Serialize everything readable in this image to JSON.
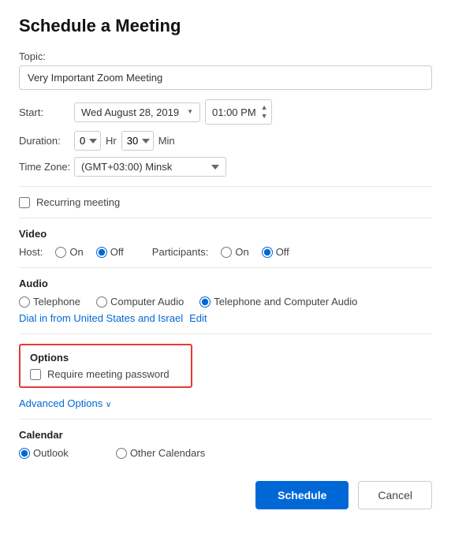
{
  "page": {
    "title": "Schedule a Meeting"
  },
  "topic": {
    "label": "Topic:",
    "value": "Very Important Zoom Meeting",
    "placeholder": "Very Important Zoom Meeting"
  },
  "start": {
    "label": "Start:",
    "date": {
      "weekday": "Wed",
      "month": "August",
      "day": "28,",
      "year": "2019",
      "display": "Wed  August  28, 2019"
    },
    "time": "01:00 PM"
  },
  "duration": {
    "label": "Duration:",
    "hours_value": "0",
    "hr_label": "Hr",
    "minutes_value": "30",
    "min_label": "Min"
  },
  "timezone": {
    "label": "Time Zone:",
    "value": "(GMT+03:00) Minsk"
  },
  "recurring": {
    "label": "Recurring meeting"
  },
  "video": {
    "title": "Video",
    "host_label": "Host:",
    "participants_label": "Participants:",
    "on_label": "On",
    "off_label": "Off"
  },
  "audio": {
    "title": "Audio",
    "telephone_label": "Telephone",
    "computer_label": "Computer Audio",
    "both_label": "Telephone and Computer Audio",
    "dial_in_text": "Dial in from United States and Israel",
    "edit_label": "Edit"
  },
  "options": {
    "title": "Options",
    "require_password_label": "Require meeting password"
  },
  "advanced_options": {
    "label": "Advanced Options",
    "chevron": "∨"
  },
  "calendar": {
    "title": "Calendar",
    "outlook_label": "Outlook",
    "other_label": "Other Calendars"
  },
  "actions": {
    "schedule_label": "Schedule",
    "cancel_label": "Cancel"
  }
}
